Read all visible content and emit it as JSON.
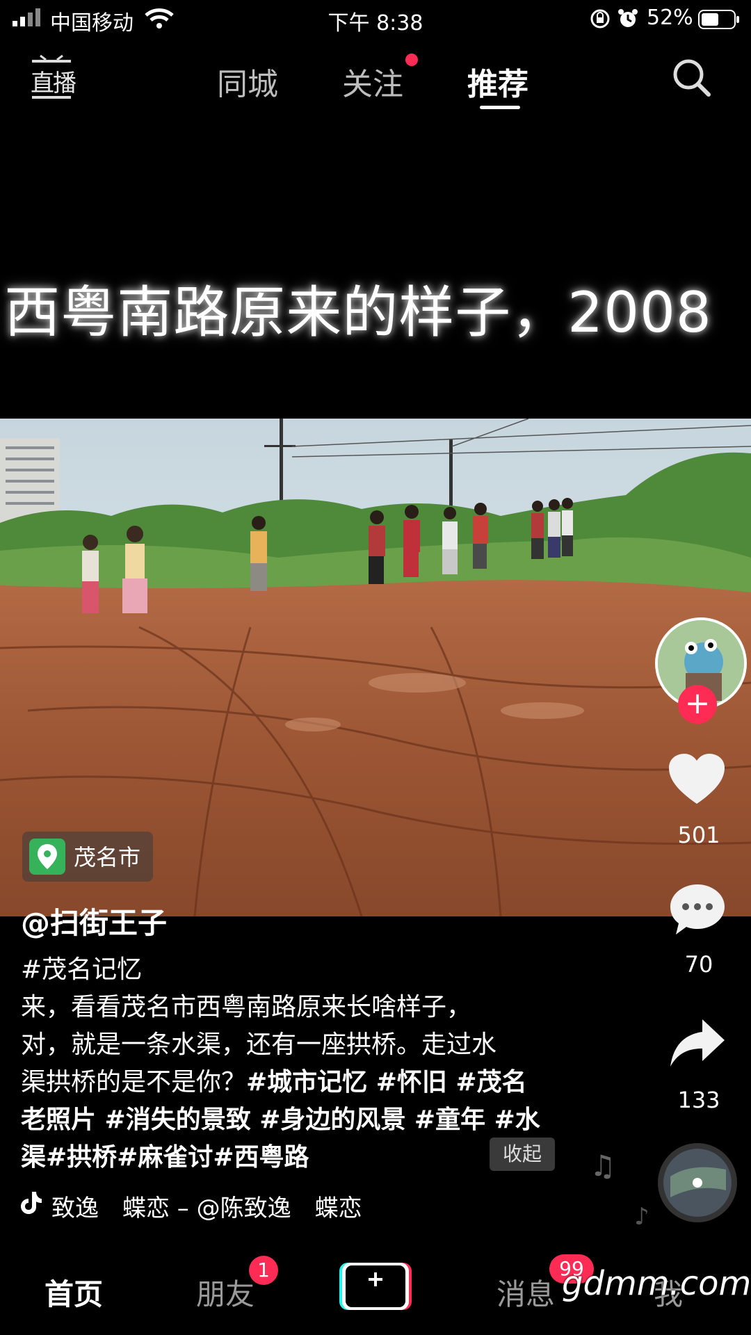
{
  "status_bar": {
    "carrier": "中国移动",
    "time": "下午 8:38",
    "battery": "52%"
  },
  "top_nav": {
    "live": "直播",
    "tabs": [
      "同城",
      "关注",
      "推荐"
    ],
    "active_tab": "推荐"
  },
  "video": {
    "caption": "西粤南路原来的样子，2008"
  },
  "actions": {
    "likes": "501",
    "comments": "70",
    "shares": "133"
  },
  "location": "茂名市",
  "author": "@扫街王子",
  "description_lines": [
    [
      {
        "t": "#茂名记忆",
        "b": false
      }
    ],
    [
      {
        "t": "来，看看茂名市西粤南路原来长啥样子，",
        "b": false
      }
    ],
    [
      {
        "t": "对，就是一条水渠，还有一座拱桥。走过水",
        "b": false
      }
    ],
    [
      {
        "t": "渠拱桥的是不是你？",
        "b": false
      },
      {
        "t": "#城市记忆 #怀旧 #茂名",
        "b": true
      }
    ],
    [
      {
        "t": "老照片 #消失的景致 #身边的风景 #童年 #水",
        "b": true
      }
    ],
    [
      {
        "t": "渠#拱桥#麻雀讨#西粤路",
        "b": true
      }
    ]
  ],
  "collapse_label": "收起",
  "music": "致逸　蝶恋 – @陈致逸　蝶恋",
  "bottom_nav": {
    "home": "首页",
    "friends": "朋友",
    "friends_badge": "1",
    "messages": "消息",
    "messages_badge": "99",
    "me": "我"
  },
  "watermark": "gdmm.com",
  "colors": {
    "accent": "#fe2c55",
    "location_green": "#35b25a"
  }
}
